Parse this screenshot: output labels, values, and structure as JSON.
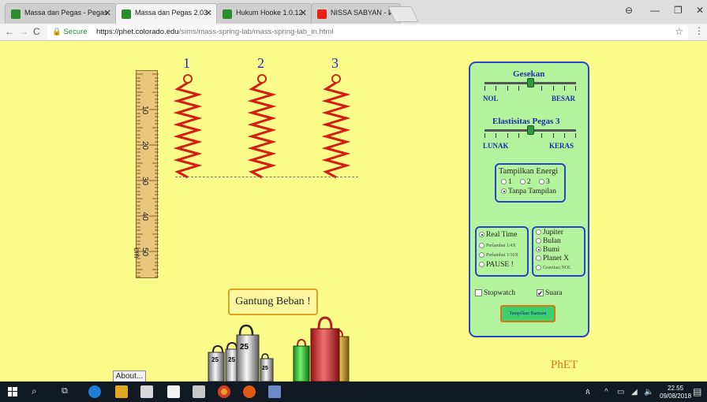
{
  "browser": {
    "tabs": [
      {
        "title": "Massa dan Pegas - Pegas",
        "active": false
      },
      {
        "title": "Massa dan Pegas 2.03",
        "active": true
      },
      {
        "title": "Hukum Hooke 1.0.12",
        "active": false
      },
      {
        "title": "NISSA SABYAN - Full",
        "active": false
      }
    ],
    "security_label": "Secure",
    "url_host": "https://phet.colorado.edu",
    "url_path": "/sims/mass-spring-lab/mass-spring-lab_in.html"
  },
  "sim": {
    "spring_labels": [
      "1",
      "2",
      "3"
    ],
    "ruler_ticks": [
      "10",
      "20",
      "30",
      "40",
      "50 cm"
    ],
    "hang_button": "Gantung Beban !",
    "about_button": "About...",
    "logo": "PhET",
    "weights": [
      "25",
      "25",
      "25",
      "25"
    ]
  },
  "panel": {
    "friction_title": "Gesekan",
    "friction_min": "NOL",
    "friction_max": "BESAR",
    "friction_level": 0.5,
    "elasticity_title": "Elastisitas Pegas 3",
    "elasticity_min": "LUNAK",
    "elasticity_max": "KERAS",
    "elasticity_level": 0.5,
    "energy_title": "Tampilkan Energi",
    "energy_options": [
      "1",
      "2",
      "3"
    ],
    "energy_none": "Tanpa Tampilan",
    "time_options": [
      "Real Time",
      "Perlambat 1/4X",
      "Perlambat 1/16X",
      "PAUSE !"
    ],
    "gravity_options": [
      "Jupiter",
      "Bulan",
      "Bumi",
      "Planet X",
      "Gravitasi NOL"
    ],
    "stopwatch_label": "Stopwatch",
    "sound_label": "Suara",
    "help_button": "Tampilkan Bantuan"
  },
  "taskbar": {
    "time": "22.55",
    "date": "09/08/2018"
  }
}
